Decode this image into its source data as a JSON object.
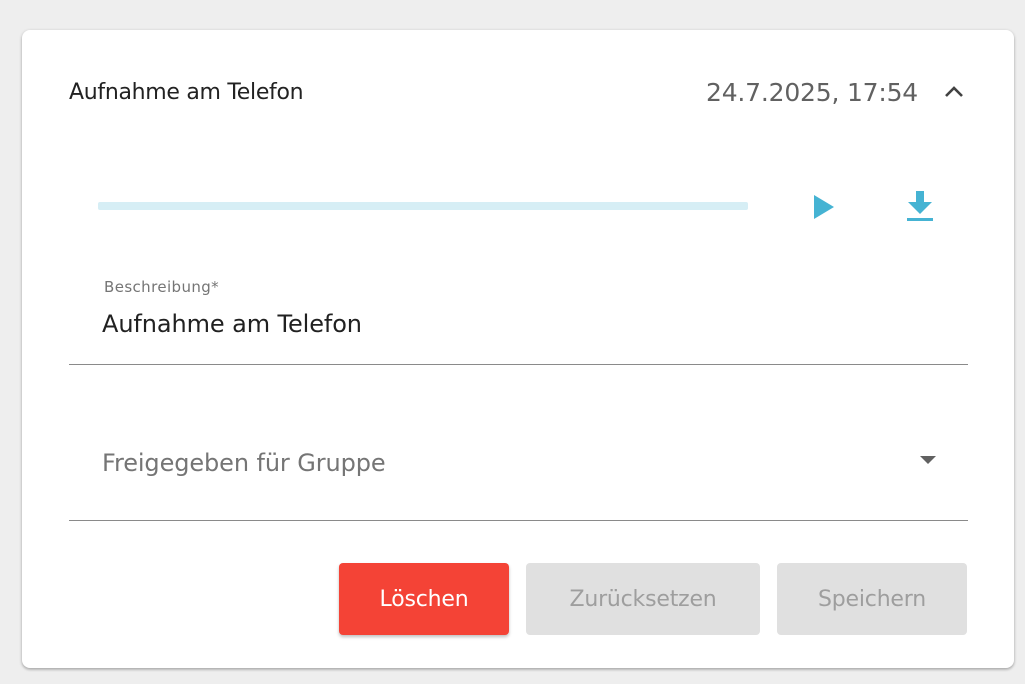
{
  "recording": {
    "title": "Aufnahme am Telefon",
    "timestamp": "24.7.2025, 17:54",
    "collapse_icon": "chevron-up-icon",
    "progress": 0
  },
  "player": {
    "play_icon": "play-icon",
    "download_icon": "download-icon",
    "accent_color": "#45b3d3",
    "track_color": "#d6eef5"
  },
  "form": {
    "description": {
      "label": "Beschreibung*",
      "value": "Aufnahme am Telefon"
    },
    "group": {
      "placeholder": "Freigegeben für Gruppe",
      "icon": "dropdown-arrow-icon"
    }
  },
  "actions": {
    "delete_label": "Löschen",
    "reset_label": "Zurücksetzen",
    "save_label": "Speichern",
    "delete_color": "#f44336",
    "disabled_color": "#e0e0e0"
  }
}
